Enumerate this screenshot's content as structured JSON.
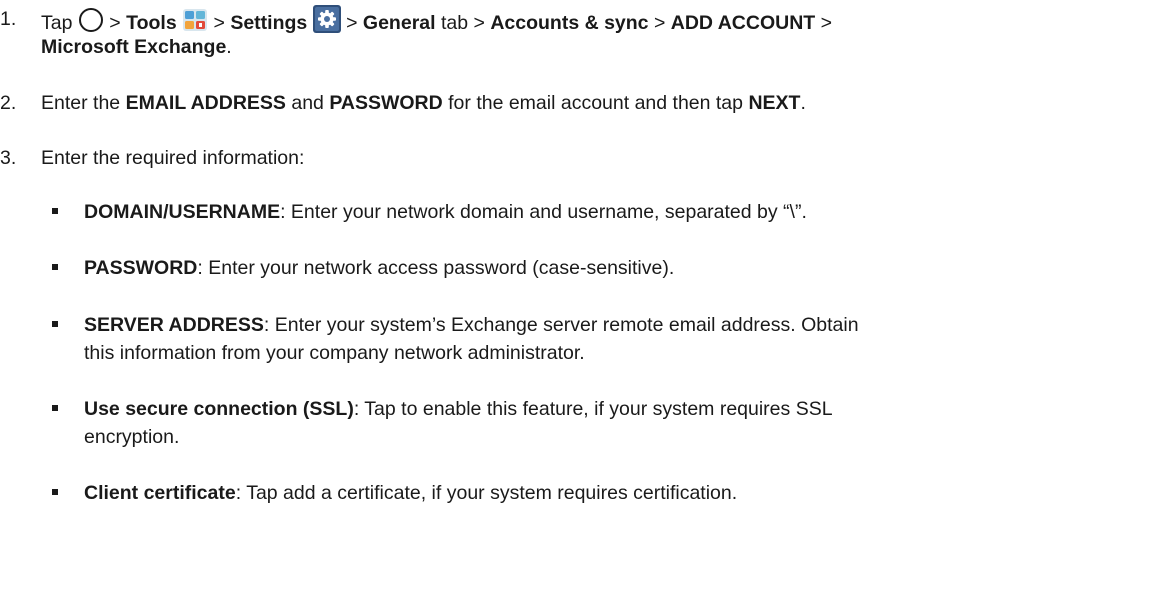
{
  "steps": [
    {
      "number": "1.",
      "tap": "Tap",
      "sep": ">",
      "tools": "Tools",
      "settings": "Settings",
      "general": "General",
      "tab": "tab",
      "accounts": "Accounts & sync",
      "add_account": "ADD ACCOUNT",
      "exchange": "Microsoft Exchange",
      "end": "."
    },
    {
      "number": "2.",
      "t1": "Enter the",
      "email": "EMAIL ADDRESS",
      "t2": "and",
      "password": "PASSWORD",
      "t3": "for the email account and then tap",
      "next": "NEXT",
      "end": "."
    },
    {
      "number": "3.",
      "text": "Enter the required information:"
    }
  ],
  "items": [
    {
      "term": "DOMAIN/USERNAME",
      "desc_1": ": Enter your network domain and username, separated by “\\”.",
      "desc_2": ""
    },
    {
      "term": "PASSWORD",
      "desc_1": ": Enter your network access password (case-sensitive).",
      "desc_2": ""
    },
    {
      "term": "SERVER ADDRESS",
      "desc_1": ": Enter your system’s Exchange server remote email address. Obtain",
      "desc_2": "this information from your company network administrator."
    },
    {
      "term": "Use secure connection (SSL)",
      "desc_1": ": Tap to enable this feature, if your system requires SSL",
      "desc_2": "encryption."
    },
    {
      "term": "Client certificate",
      "desc_1": ": Tap add a certificate, if your system requires certification.",
      "desc_2": ""
    }
  ],
  "icons": {
    "home": "home-circle-icon",
    "tools": "tools-folder-icon",
    "settings": "settings-gear-icon"
  }
}
